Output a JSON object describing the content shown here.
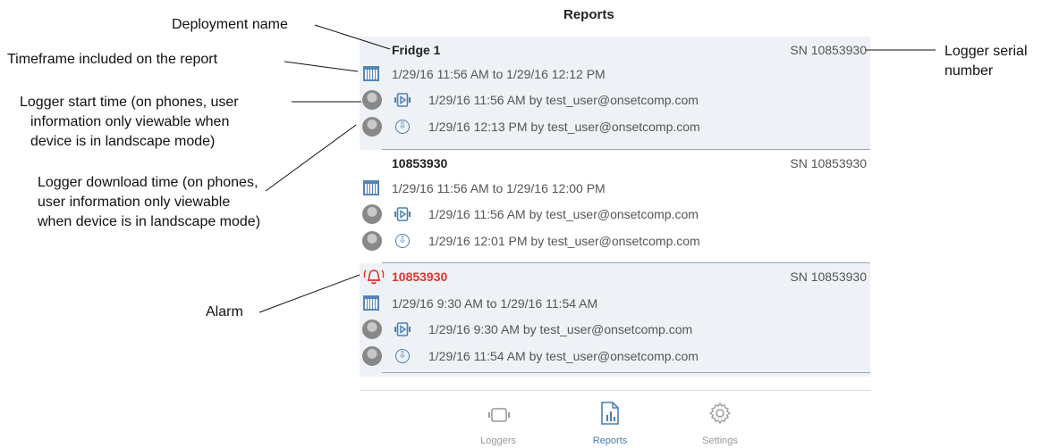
{
  "page_title": "Reports",
  "reports": [
    {
      "name": "Fridge 1",
      "serial": "SN 10853930",
      "timeframe": "1/29/16 11:56 AM to 1/29/16 12:12 PM",
      "start": "1/29/16 11:56 AM by test_user@onsetcomp.com",
      "download": "1/29/16 12:13 PM by test_user@onsetcomp.com"
    },
    {
      "name": "10853930",
      "serial": "SN 10853930",
      "timeframe": "1/29/16 11:56 AM to 1/29/16 12:00 PM",
      "start": "1/29/16 11:56 AM by test_user@onsetcomp.com",
      "download": "1/29/16 12:01 PM by test_user@onsetcomp.com"
    },
    {
      "name": "10853930",
      "serial": "SN 10853930",
      "timeframe": "1/29/16 9:30 AM to 1/29/16 11:54 AM",
      "start": "1/29/16 9:30 AM by test_user@onsetcomp.com",
      "download": "1/29/16 11:54 AM by test_user@onsetcomp.com",
      "alarm": true
    }
  ],
  "tabs": [
    {
      "label": "Loggers",
      "icon": "logger-icon"
    },
    {
      "label": "Reports",
      "icon": "reports-icon",
      "active": true
    },
    {
      "label": "Settings",
      "icon": "gear-icon"
    }
  ],
  "annotations": {
    "deployment_name": "Deployment name",
    "timeframe": "Timeframe included on the report",
    "start_time": [
      "Logger start time (on phones, user",
      "information only viewable when",
      "device is in landscape mode)"
    ],
    "download_time": [
      "Logger download time (on phones,",
      "user information only viewable",
      "when device is in landscape mode)"
    ],
    "alarm": "Alarm",
    "serial": [
      "Logger serial",
      "number"
    ]
  },
  "colors": {
    "accent": "#4a7fb5",
    "alarm": "#e0342f",
    "shaded_row": "#eef2f6"
  }
}
